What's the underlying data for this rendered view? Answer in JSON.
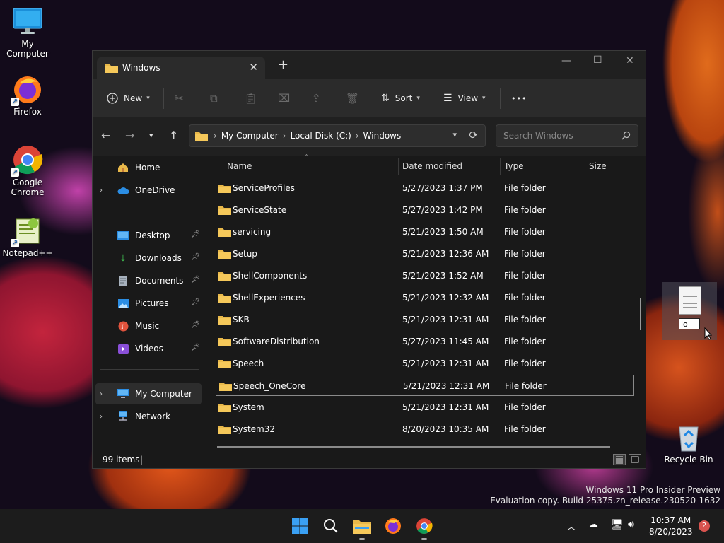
{
  "desktop": {
    "icons": [
      {
        "label": "My Computer"
      },
      {
        "label": "Firefox"
      },
      {
        "label": "Google Chrome"
      },
      {
        "label": "Notepad++"
      },
      {
        "label": "Recycle Bin"
      }
    ],
    "dragged_file": {
      "rename_value": "lo"
    },
    "watermark": {
      "line1": "Windows 11 Pro Insider Preview",
      "line2": "Evaluation copy. Build 25375.zn_release.230520-1632"
    }
  },
  "explorer": {
    "tab_title": "Windows",
    "new_tab_label": "+",
    "toolbar": {
      "new_label": "New",
      "sort_label": "Sort",
      "view_label": "View",
      "more_label": "•••"
    },
    "breadcrumb": [
      "My Computer",
      "Local Disk (C:)",
      "Windows"
    ],
    "search_placeholder": "Search Windows",
    "nav": {
      "home": "Home",
      "onedrive": "OneDrive",
      "desktop": "Desktop",
      "downloads": "Downloads",
      "documents": "Documents",
      "pictures": "Pictures",
      "music": "Music",
      "videos": "Videos",
      "my_computer": "My Computer",
      "network": "Network"
    },
    "columns": {
      "name": "Name",
      "date": "Date modified",
      "type": "Type",
      "size": "Size"
    },
    "rows": [
      {
        "name": "ServiceProfiles",
        "date": "5/27/2023 1:37 PM",
        "type": "File folder"
      },
      {
        "name": "ServiceState",
        "date": "5/27/2023 1:42 PM",
        "type": "File folder"
      },
      {
        "name": "servicing",
        "date": "5/21/2023 1:50 AM",
        "type": "File folder"
      },
      {
        "name": "Setup",
        "date": "5/21/2023 12:36 AM",
        "type": "File folder"
      },
      {
        "name": "ShellComponents",
        "date": "5/21/2023 1:52 AM",
        "type": "File folder"
      },
      {
        "name": "ShellExperiences",
        "date": "5/21/2023 12:32 AM",
        "type": "File folder"
      },
      {
        "name": "SKB",
        "date": "5/21/2023 12:31 AM",
        "type": "File folder"
      },
      {
        "name": "SoftwareDistribution",
        "date": "5/27/2023 11:45 AM",
        "type": "File folder"
      },
      {
        "name": "Speech",
        "date": "5/21/2023 12:31 AM",
        "type": "File folder"
      },
      {
        "name": "Speech_OneCore",
        "date": "5/21/2023 12:31 AM",
        "type": "File folder"
      },
      {
        "name": "System",
        "date": "5/21/2023 12:31 AM",
        "type": "File folder"
      },
      {
        "name": "System32",
        "date": "8/20/2023 10:35 AM",
        "type": "File folder"
      }
    ],
    "status": "99 items"
  },
  "taskbar": {
    "time": "10:37 AM",
    "date": "8/20/2023",
    "notification_count": "2"
  },
  "colors": {
    "accent": "#0078d4",
    "folder": "#e8b84a",
    "window_bg": "#191919"
  }
}
